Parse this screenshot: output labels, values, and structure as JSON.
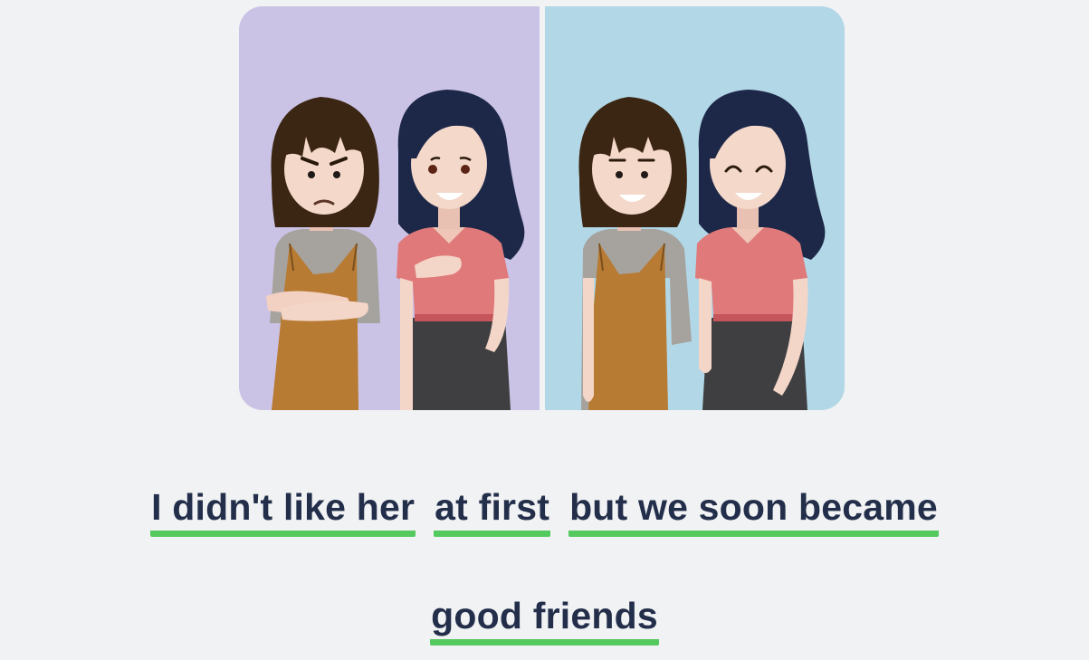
{
  "illustration": {
    "left_background": "#cbc3e6",
    "right_background": "#b2d7e7",
    "divider": "#f3f3f6"
  },
  "sentence": {
    "chunks": [
      "I didn't like her",
      "at first",
      "but we soon became",
      "good friends"
    ],
    "underline_color": "#54c95e",
    "text_color": "#232f4a"
  }
}
